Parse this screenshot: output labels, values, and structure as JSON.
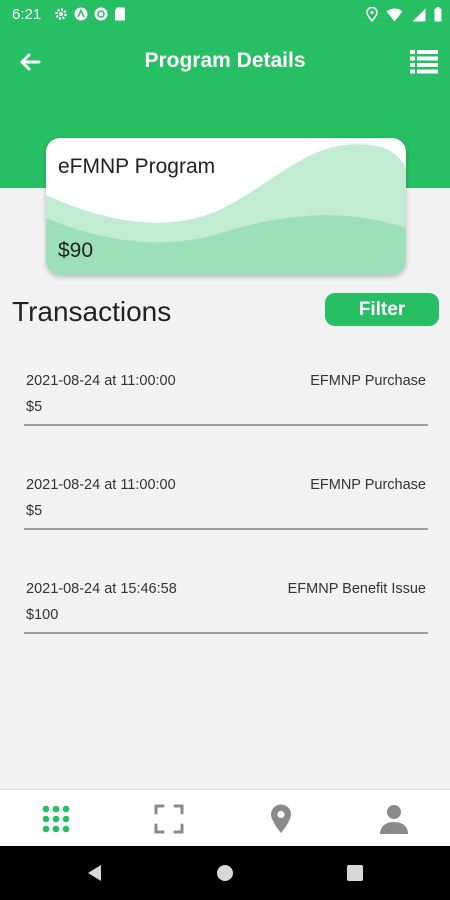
{
  "status_bar": {
    "time": "6:21"
  },
  "header": {
    "title": "Program Details"
  },
  "program_card": {
    "name": "eFMNP Program",
    "balance": "$90"
  },
  "transactions": {
    "heading": "Transactions",
    "filter_label": "Filter",
    "items": [
      {
        "datetime": "2021-08-24 at 11:00:00",
        "type": "EFMNP Purchase",
        "amount": "$5"
      },
      {
        "datetime": "2021-08-24 at 11:00:00",
        "type": "EFMNP Purchase",
        "amount": "$5"
      },
      {
        "datetime": "2021-08-24 at 15:46:58",
        "type": "EFMNP Benefit Issue",
        "amount": "$100"
      }
    ]
  },
  "bottom_nav": {
    "items": [
      {
        "icon": "grid-icon",
        "active": true
      },
      {
        "icon": "scan-icon",
        "active": false
      },
      {
        "icon": "map-pin-icon",
        "active": false
      },
      {
        "icon": "profile-icon",
        "active": false
      }
    ]
  },
  "colors": {
    "brand": "#26bf63",
    "inactive_icon": "#8a8a8a"
  }
}
